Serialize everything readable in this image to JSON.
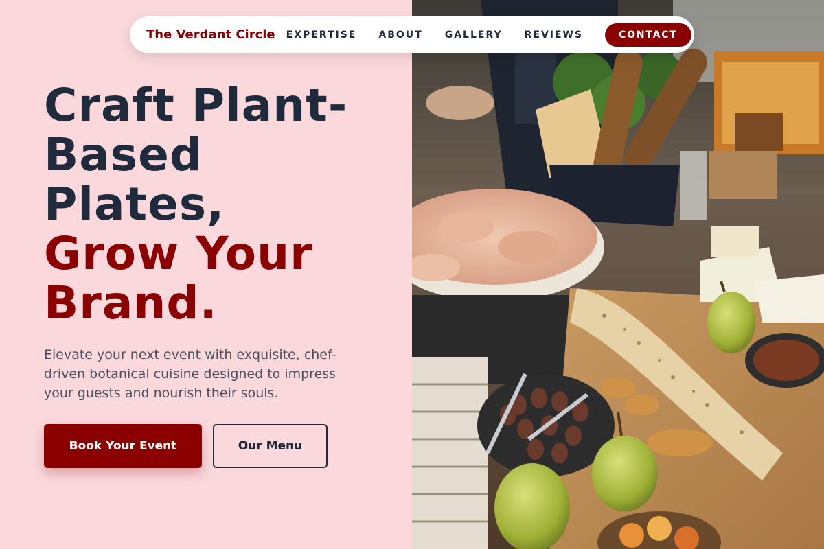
{
  "brand": {
    "name": "The Verdant Circle"
  },
  "nav": {
    "links": [
      "EXPERTISE",
      "ABOUT",
      "GALLERY",
      "REVIEWS"
    ],
    "cta_label": "CONTACT"
  },
  "hero": {
    "title_lines": [
      "Craft Plant-",
      "Based",
      "Plates,"
    ],
    "accent_lines": [
      "Grow Your",
      "Brand."
    ],
    "subtitle": "Elevate your next event with exquisite, chef-driven botanical cuisine designed to impress your guests and nourish their souls.",
    "primary_button": "Book Your Event",
    "secondary_button": "Our Menu"
  },
  "colors": {
    "accent": "#8b0000",
    "background": "#fad8dc",
    "text_dark": "#1f2a3c"
  },
  "photo": {
    "subject": "catering-grazing-table-image"
  }
}
